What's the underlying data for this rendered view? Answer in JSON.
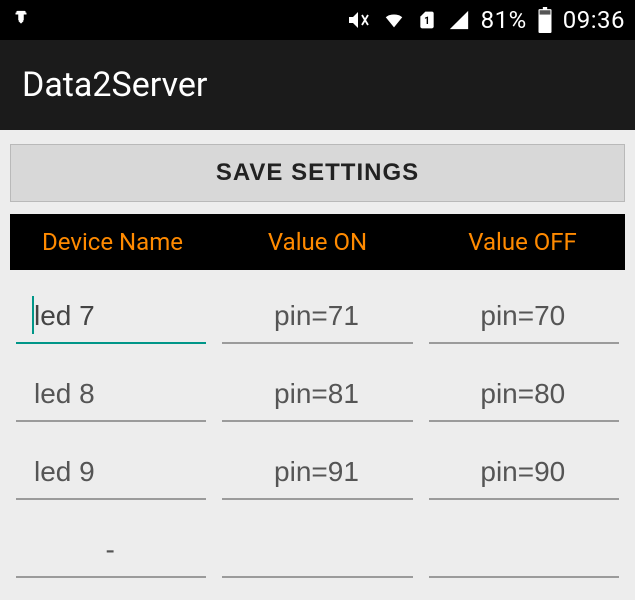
{
  "status_bar": {
    "battery_text": "81%",
    "time": "09:36"
  },
  "app_bar": {
    "title": "Data2Server"
  },
  "toolbar": {
    "save_label": "SAVE SETTINGS"
  },
  "table": {
    "headers": {
      "name": "Device Name",
      "on": "Value ON",
      "off": "Value OFF"
    },
    "rows": [
      {
        "name": "led 7",
        "on": "pin=71",
        "off": "pin=70",
        "focused": true
      },
      {
        "name": "led 8",
        "on": "pin=81",
        "off": "pin=80",
        "focused": false
      },
      {
        "name": "led 9",
        "on": "pin=91",
        "off": "pin=90",
        "focused": false
      },
      {
        "name": "-",
        "on": "",
        "off": "",
        "focused": false
      }
    ]
  },
  "colors": {
    "accent": "#FF8A00",
    "focus": "#009688"
  }
}
